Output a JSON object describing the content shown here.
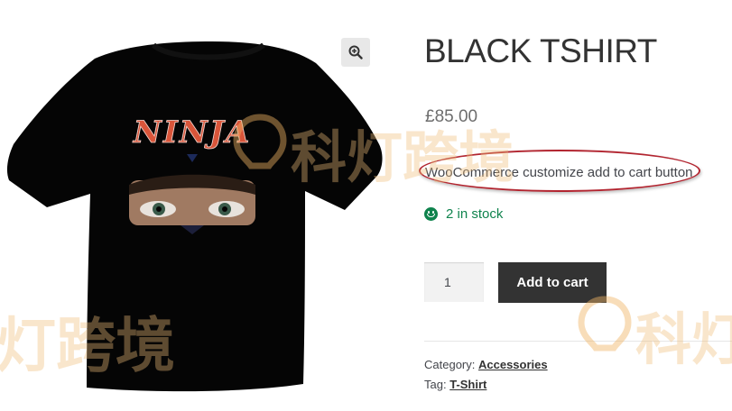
{
  "product": {
    "title": "BLACK TSHIRT",
    "price": "£85.00",
    "short_description": "WooCommerce customize add to cart button",
    "stock": "2 in stock",
    "quantity": "1",
    "add_to_cart_label": "Add to cart",
    "category_label": "Category:",
    "category_link": "Accessories",
    "tag_label": "Tag:",
    "tag_link": "T-Shirt",
    "image_text": "NINJA"
  },
  "watermark": {
    "top_text": "科灯跨境",
    "bottom_left_text": "灯跨境",
    "bottom_right_text": "科灯"
  },
  "colors": {
    "heading": "#333333",
    "in_stock": "#0f834d",
    "button_bg": "#333333",
    "highlight_ring": "#b22530"
  },
  "icons": {
    "zoom": "magnifier-plus-icon",
    "stock": "smiley-icon"
  }
}
